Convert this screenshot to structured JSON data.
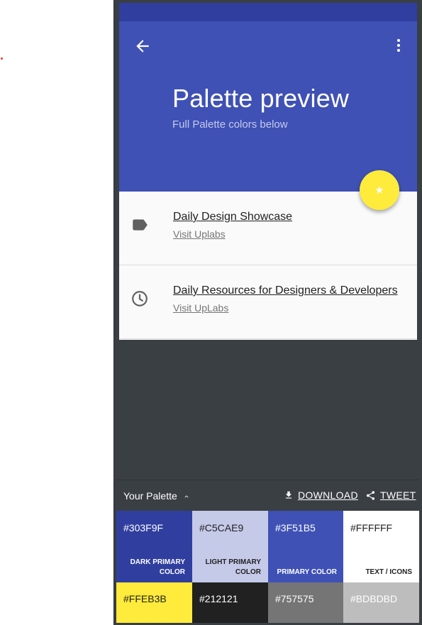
{
  "app": {
    "title": "Palette preview",
    "subtitle": "Full Palette colors below",
    "fab_icon": "star-icon"
  },
  "list": [
    {
      "icon": "label-icon",
      "primary": "Daily Design Showcase",
      "secondary": "Visit Uplabs"
    },
    {
      "icon": "clock-icon",
      "primary": "Daily Resources for Designers & Developers",
      "secondary": "Visit UpLabs"
    }
  ],
  "palette": {
    "title": "Your Palette",
    "download_label": "DOWNLOAD",
    "tweet_label": "TWEET",
    "swatches": [
      {
        "hex": "#303F9F",
        "name": "DARK PRIMARY COLOR",
        "bg": "#303f9f",
        "fg": "#ffffff"
      },
      {
        "hex": "#C5CAE9",
        "name": "LIGHT PRIMARY COLOR",
        "bg": "#c5cae9",
        "fg": "#212121"
      },
      {
        "hex": "#3F51B5",
        "name": "PRIMARY COLOR",
        "bg": "#3f51b5",
        "fg": "#ffffff"
      },
      {
        "hex": "#FFFFFF",
        "name": "TEXT / ICONS",
        "bg": "#ffffff",
        "fg": "#212121"
      },
      {
        "hex": "#FFEB3B",
        "bg": "#ffeb3b",
        "fg": "#212121"
      },
      {
        "hex": "#212121",
        "bg": "#212121",
        "fg": "#ffffff"
      },
      {
        "hex": "#757575",
        "bg": "#757575",
        "fg": "#ffffff"
      },
      {
        "hex": "#BDBDBD",
        "bg": "#bdbdbd",
        "fg": "#ffffff"
      }
    ]
  },
  "colors": {
    "primary": "#3f51b5",
    "primary_dark": "#303f9f",
    "accent": "#ffeb3b",
    "frame_bg": "#3a3f44"
  }
}
